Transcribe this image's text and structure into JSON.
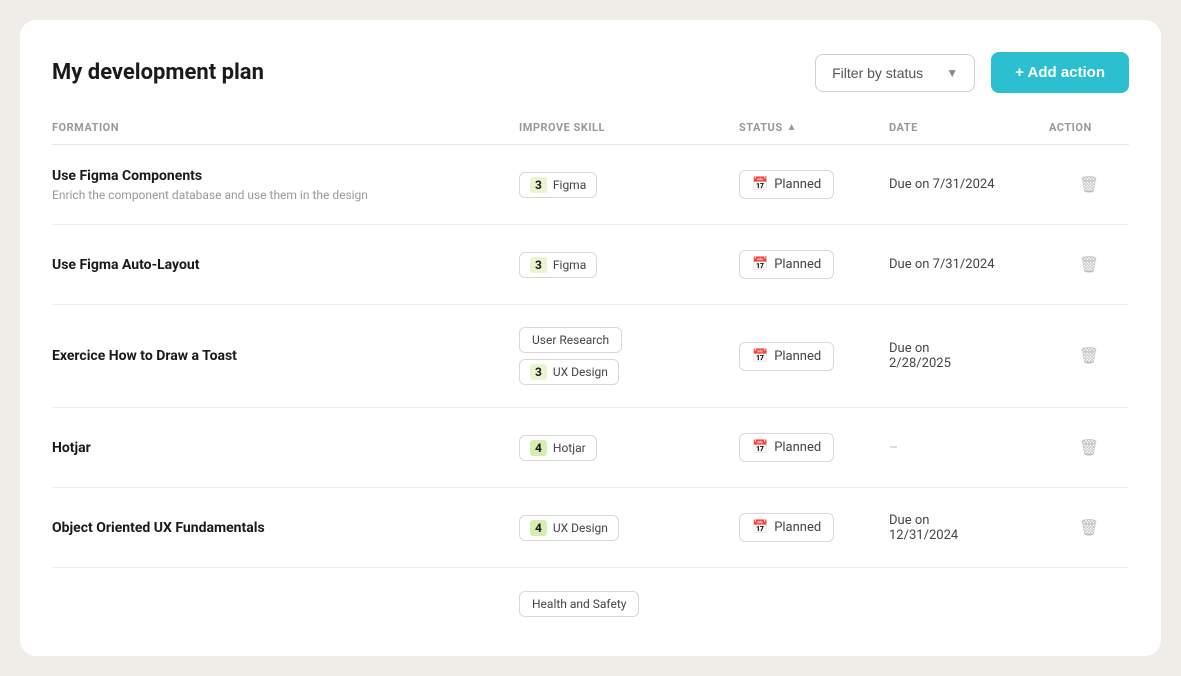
{
  "page": {
    "title": "My development plan",
    "filter": {
      "label": "Filter by status",
      "placeholder": "Filter by status"
    },
    "add_action_label": "+ Add action"
  },
  "table": {
    "headers": [
      {
        "id": "formation",
        "label": "FORMATION"
      },
      {
        "id": "improve_skill",
        "label": "IMPROVE SKILL"
      },
      {
        "id": "status",
        "label": "STATUS"
      },
      {
        "id": "date",
        "label": "DATE"
      },
      {
        "id": "action",
        "label": "ACTION"
      }
    ],
    "rows": [
      {
        "id": 1,
        "title": "Use Figma Components",
        "description": "Enrich the component database and use them in the design",
        "skills": [
          {
            "level": "3",
            "label": "Figma",
            "plain": false
          }
        ],
        "status": "Planned",
        "date": "Due on 7/31/2024"
      },
      {
        "id": 2,
        "title": "Use Figma Auto-Layout",
        "description": "",
        "skills": [
          {
            "level": "3",
            "label": "Figma",
            "plain": false
          }
        ],
        "status": "Planned",
        "date": "Due on 7/31/2024"
      },
      {
        "id": 3,
        "title": "Exercice How to Draw a Toast",
        "description": "",
        "skills": [
          {
            "level": null,
            "label": "User Research",
            "plain": true
          },
          {
            "level": "3",
            "label": "UX Design",
            "plain": false
          }
        ],
        "status": "Planned",
        "date": "Due on\n2/28/2025"
      },
      {
        "id": 4,
        "title": "Hotjar",
        "description": "",
        "skills": [
          {
            "level": "4",
            "label": "Hotjar",
            "plain": false,
            "level_style": "level-4"
          }
        ],
        "status": "Planned",
        "date": "-"
      },
      {
        "id": 5,
        "title": "Object Oriented UX Fundamentals",
        "description": "",
        "skills": [
          {
            "level": "4",
            "label": "UX Design",
            "plain": false,
            "level_style": "level-4"
          }
        ],
        "status": "Planned",
        "date": "Due on\n12/31/2024"
      }
    ],
    "partial_row": {
      "skill_label": "Health and Safety"
    }
  }
}
